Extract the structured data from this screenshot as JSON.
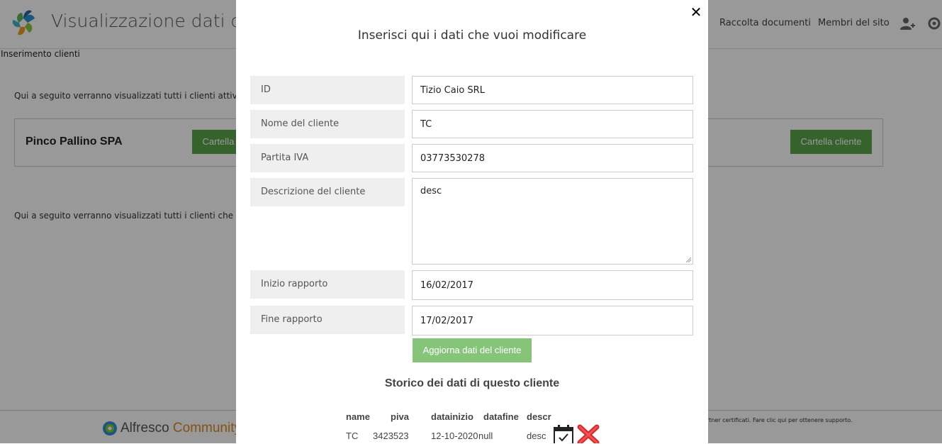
{
  "header": {
    "site_title": "Visualizzazione dati clienti",
    "nav": {
      "documents": "Raccolta documenti",
      "members": "Membri del sito"
    }
  },
  "breadcrumb": "Inserimento clienti",
  "main": {
    "intro_active": "Qui a seguito verranno visualizzati tutti i clienti attivi nell'azienda",
    "client_card": {
      "name": "Pinco Pallino SPA",
      "folder_button": "Cartella cliente"
    },
    "intro_inactive": "Qui a seguito verranno visualizzati tutti i clienti che non sono più attivi"
  },
  "footer": {
    "brand": "Alfresco",
    "brand_suffix": "Community",
    "note": "rtner certificati. Fare clic qui per ottenere supporto."
  },
  "modal": {
    "close_symbol": "✕",
    "title": "Inserisci qui i dati che vuoi modificare",
    "fields": {
      "id": {
        "label": "ID",
        "value": "Tizio Caio SRL"
      },
      "nome": {
        "label": "Nome del cliente",
        "value": "TC"
      },
      "piva": {
        "label": "Partita IVA",
        "value": "03773530278"
      },
      "descrizione": {
        "label": "Descrizione del cliente",
        "value": "desc"
      },
      "inizio": {
        "label": "Inizio rapporto",
        "value": "16/02/2017"
      },
      "fine": {
        "label": "Fine rapporto",
        "value": "17/02/2017"
      }
    },
    "update_button": "Aggiorna dati del cliente",
    "history": {
      "title": "Storico dei dati di questo cliente",
      "columns": [
        "name",
        "piva",
        "datainizio",
        "datafine",
        "descr"
      ],
      "rows": [
        {
          "name": "TC",
          "piva": "3423523",
          "datainizio": "12-10-2020",
          "datafine": "null",
          "descr": "desc"
        }
      ]
    }
  },
  "colors": {
    "green_button": "#5aa34a",
    "update_button": "#86c47a",
    "overlay": "rgba(0,0,0,0.4)",
    "label_bg": "#efefef",
    "brand_orange": "#e0882a"
  },
  "icons": [
    "alfresco-logo-icon",
    "add-user-icon",
    "gear-icon",
    "close-icon",
    "calendar-check-icon",
    "delete-x-icon"
  ]
}
